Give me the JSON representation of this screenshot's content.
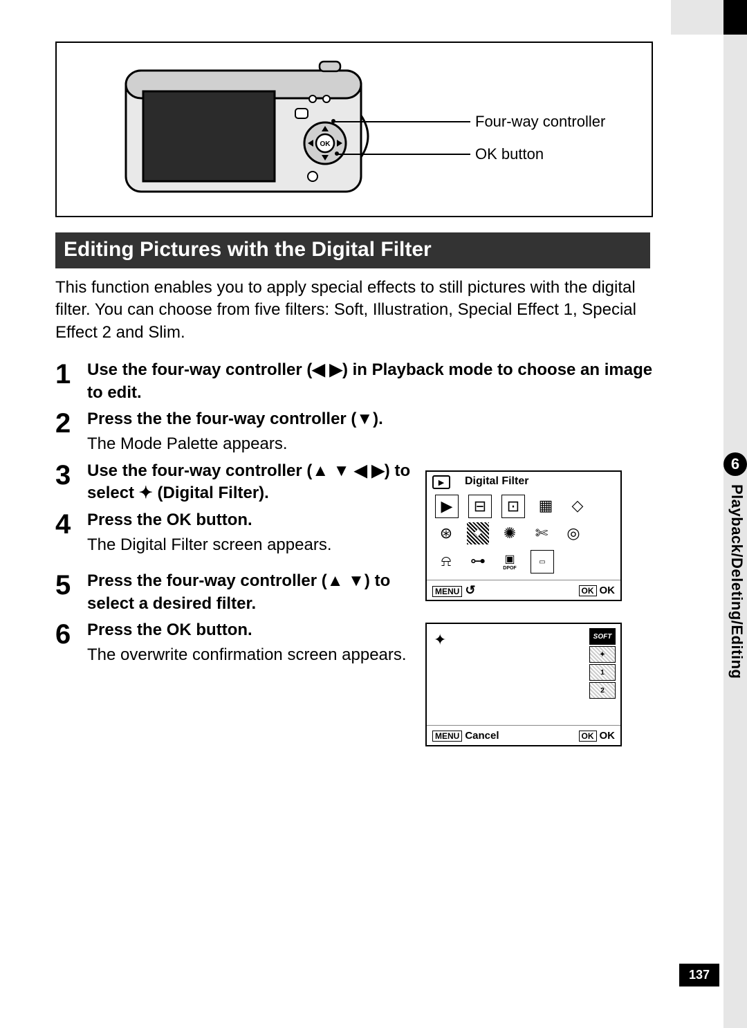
{
  "diagram": {
    "callout1": "Four-way controller",
    "callout2": "OK button"
  },
  "heading": "Editing Pictures with the Digital Filter",
  "intro": "This function enables you to apply special effects to still pictures with the digital filter. You can choose from five filters: Soft, Illustration, Special Effect 1, Special Effect 2 and Slim.",
  "steps": {
    "s1_num": "1",
    "s1_bold": "Use the four-way controller (◀ ▶) in Playback mode to choose an image to edit.",
    "s2_num": "2",
    "s2_bold": "Press the the four-way controller (▼).",
    "s2_sub": "The Mode Palette appears.",
    "s3_num": "3",
    "s3_bold_a": "Use the four-way controller (▲ ▼ ◀ ▶) to select ",
    "s3_bold_b": " (Digital Filter).",
    "s4_num": "4",
    "s4_bold": "Press the OK button.",
    "s4_sub": "The Digital Filter screen appears.",
    "s5_num": "5",
    "s5_bold": "Press the four-way controller (▲ ▼) to select a desired filter.",
    "s6_num": "6",
    "s6_bold": "Press the OK button.",
    "s6_sub": "The overwrite confirmation screen appears."
  },
  "screen1": {
    "title": "Digital Filter",
    "menu_label": "MENU",
    "back_glyph": "↺",
    "ok_key": "OK",
    "ok_label": "OK",
    "icons_row1": [
      "▶",
      "⊟",
      "⊡",
      "▦",
      "◇"
    ],
    "icons_row2": [
      "⊛",
      "✦",
      "✺",
      "✄",
      "◎"
    ],
    "icons_row3": [
      "⍾",
      "⊶",
      "▣",
      "▭"
    ],
    "row3_sub": "DPOF"
  },
  "screen2": {
    "star": "✦",
    "effects": [
      "SOFT",
      "✦",
      "1",
      "2"
    ],
    "menu_label": "MENU",
    "cancel": "Cancel",
    "ok_key": "OK",
    "ok_label": "OK"
  },
  "sidebar": {
    "chapter_num": "6",
    "chapter_title": "Playback/Deleting/Editing"
  },
  "page_number": "137"
}
